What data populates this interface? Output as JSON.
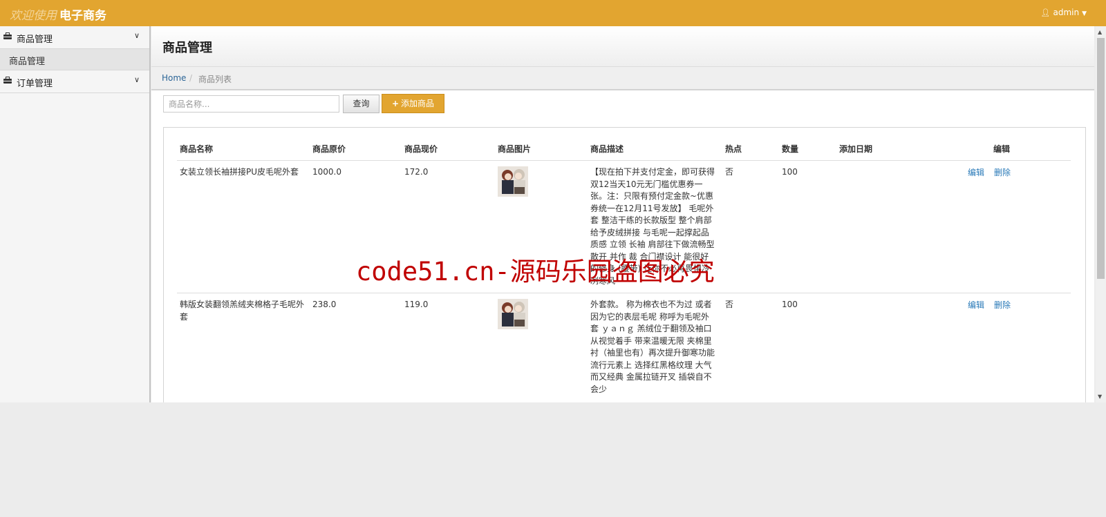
{
  "header": {
    "welcome": "欢迎使用",
    "app_name": "电子商务",
    "user": "admin"
  },
  "sidebar": {
    "groups": [
      {
        "label": "商品管理",
        "items": [
          {
            "label": "商品管理"
          }
        ]
      },
      {
        "label": "订单管理",
        "items": []
      }
    ]
  },
  "main": {
    "title": "商品管理",
    "breadcrumb": {
      "home": "Home",
      "current": "商品列表"
    },
    "search": {
      "placeholder": "商品名称...",
      "query_label": "查询",
      "add_label": "添加商品"
    },
    "table": {
      "columns": [
        "商品名称",
        "商品原价",
        "商品现价",
        "商品图片",
        "商品描述",
        "热点",
        "数量",
        "添加日期",
        "编辑"
      ],
      "rows": [
        {
          "name": "女装立领长袖拼接PU皮毛呢外套",
          "original_price": "1000.0",
          "current_price": "172.0",
          "description": "【现在拍下并支付定金，即可获得双12当天10元无门槛优惠券一张。注：只限有预付定金款~优惠券统一在12月11号发放】 毛呢外套 整洁干练的长款版型 整个肩部给予皮绒拼接 与毛呢一起撑起品质感 立领 长袖 肩部往下做流畅型散开 并作 裁 合门襟设计 能很好的修身 (腰带) 让你不必再畏惧冷冽寒风",
          "hot": "否",
          "quantity": "100",
          "date": "",
          "edit": "编辑",
          "delete": "删除"
        },
        {
          "name": "韩版女装翻领羔绒夹棉格子毛呢外套",
          "original_price": "238.0",
          "current_price": "119.0",
          "description": "外套款。 称为棉衣也不为过 或者因为它的表层毛呢 称呼为毛呢外套 ｙａｎｇ 羔绒位于翻领及袖口 从视觉着手 带来温暖无限 夹棉里衬（袖里也有）再次提升御寒功能 流行元素上 选择红黑格纹理 大气而又经典 金属拉链开叉 插袋自不会少",
          "hot": "否",
          "quantity": "100",
          "date": "",
          "edit": "编辑",
          "delete": "删除"
        }
      ]
    }
  },
  "watermark": "code51.cn-源码乐园盗图必究",
  "colors": {
    "accent": "#e2a530",
    "link": "#2a7ab8",
    "watermark": "#c00000"
  },
  "icons": {
    "user": "user-icon",
    "caret": "caret-down-icon",
    "briefcase": "briefcase-icon",
    "chevron": "chevron-down-icon"
  }
}
